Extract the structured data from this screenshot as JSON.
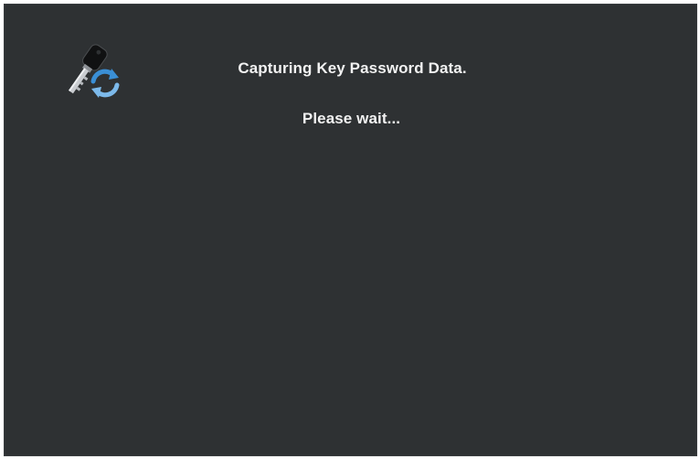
{
  "dialog": {
    "title": "Capturing Key Password Data.",
    "status": "Please wait...",
    "icon": "key-sync-icon"
  },
  "colors": {
    "background": "#2e3133",
    "text": "#f2f2f2",
    "accent": "#3a8fd6"
  }
}
